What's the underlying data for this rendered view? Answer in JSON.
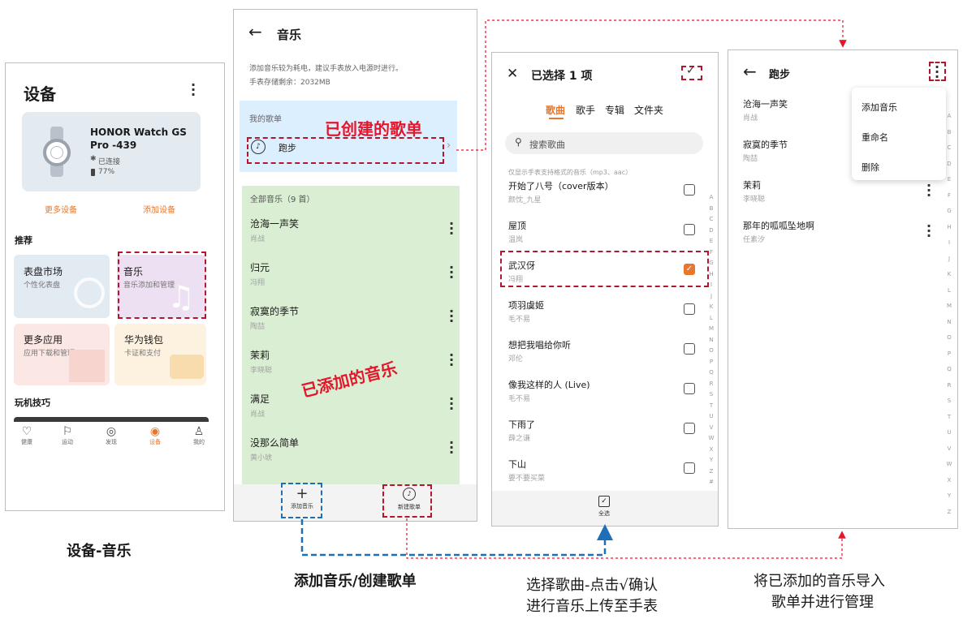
{
  "phone1": {
    "title": "设备",
    "device_name_line1": "HONOR Watch GS",
    "device_name_line2": "Pro -439",
    "connection": "已连接",
    "battery": "77%",
    "more_devices": "更多设备",
    "add_device": "添加设备",
    "recommend_heading": "推荐",
    "cards": [
      {
        "title": "表盘市场",
        "subtitle": "个性化表盘"
      },
      {
        "title": "音乐",
        "subtitle": "音乐添加和管理"
      },
      {
        "title": "更多应用",
        "subtitle": "应用下载和管理"
      },
      {
        "title": "华为钱包",
        "subtitle": "卡证和支付"
      }
    ],
    "tips_heading": "玩机技巧",
    "nav": [
      "健康",
      "运动",
      "发现",
      "设备",
      "我的"
    ]
  },
  "phone2": {
    "title": "音乐",
    "note_line1": "添加音乐较为耗电，建议手表放入电源时进行。",
    "note_line2": "手表存储剩余：2032MB",
    "my_playlists_label": "我的歌单",
    "playlist_name": "跑步",
    "all_music_label": "全部音乐（9 首）",
    "songs": [
      {
        "title": "沧海一声笑",
        "artist": "肖战"
      },
      {
        "title": "归元",
        "artist": "冯翔"
      },
      {
        "title": "寂寞的季节",
        "artist": "陶喆"
      },
      {
        "title": "茉莉",
        "artist": "李晓聪"
      },
      {
        "title": "满足",
        "artist": "肖战"
      },
      {
        "title": "没那么简单",
        "artist": "黄小琥"
      }
    ],
    "add_music_button": "添加音乐",
    "create_playlist_button": "新建歌单",
    "annotation_created": "已创建的歌单",
    "annotation_added": "已添加的音乐"
  },
  "phone3": {
    "title": "已选择 1 项",
    "tabs": [
      "歌曲",
      "歌手",
      "专辑",
      "文件夹"
    ],
    "search_placeholder": "搜索歌曲",
    "format_note": "仅显示手表支持格式的音乐（mp3、aac）",
    "songs": [
      {
        "title": "开始了八号（cover版本）",
        "artist": "颜忱_九星",
        "checked": false
      },
      {
        "title": "屋顶",
        "artist": "温岚",
        "checked": false
      },
      {
        "title": "武汉伢",
        "artist": "冯翔",
        "checked": true
      },
      {
        "title": "项羽虞姬",
        "artist": "毛不易",
        "checked": false
      },
      {
        "title": "想把我唱给你听",
        "artist": "邓伦",
        "checked": false
      },
      {
        "title": "像我这样的人 (Live)",
        "artist": "毛不易",
        "checked": false
      },
      {
        "title": "下雨了",
        "artist": "薛之谦",
        "checked": false
      },
      {
        "title": "下山",
        "artist": "要不要买菜",
        "checked": false
      }
    ],
    "select_all": "全选",
    "alphabet": [
      "A",
      "B",
      "C",
      "D",
      "E",
      "F",
      "G",
      "H",
      "I",
      "J",
      "K",
      "L",
      "M",
      "N",
      "O",
      "P",
      "Q",
      "R",
      "S",
      "T",
      "U",
      "V",
      "W",
      "X",
      "Y",
      "Z",
      "#"
    ]
  },
  "phone4": {
    "title": "跑步",
    "songs": [
      {
        "title": "沧海一声笑",
        "artist": "肖战"
      },
      {
        "title": "寂寞的季节",
        "artist": "陶喆"
      },
      {
        "title": "茉莉",
        "artist": "李晓聪"
      },
      {
        "title": "那年的呱呱坠地啊",
        "artist": "任素汐"
      }
    ],
    "menu": [
      "添加音乐",
      "重命名",
      "删除"
    ],
    "alphabet": [
      "A",
      "B",
      "C",
      "D",
      "E",
      "F",
      "G",
      "H",
      "I",
      "J",
      "K",
      "L",
      "M",
      "N",
      "O",
      "P",
      "Q",
      "R",
      "S",
      "T",
      "U",
      "V",
      "W",
      "X",
      "Y",
      "Z"
    ]
  },
  "captions": {
    "c1": "设备-音乐",
    "c2": "添加音乐/创建歌单",
    "c3_line1": "选择歌曲-点击√确认",
    "c3_line2": "进行音乐上传至手表",
    "c4_line1": "将已添加的音乐导入",
    "c4_line2": "歌单并进行管理"
  },
  "colors": {
    "accent_orange": "#e8762c",
    "annotation_red": "#e5152b",
    "dash_red": "#b4172b",
    "dash_blue": "#1f6fb6",
    "music_card": "#ece0f2",
    "playlist_bg": "#dcefff",
    "music_list_bg": "#d9eed3"
  }
}
